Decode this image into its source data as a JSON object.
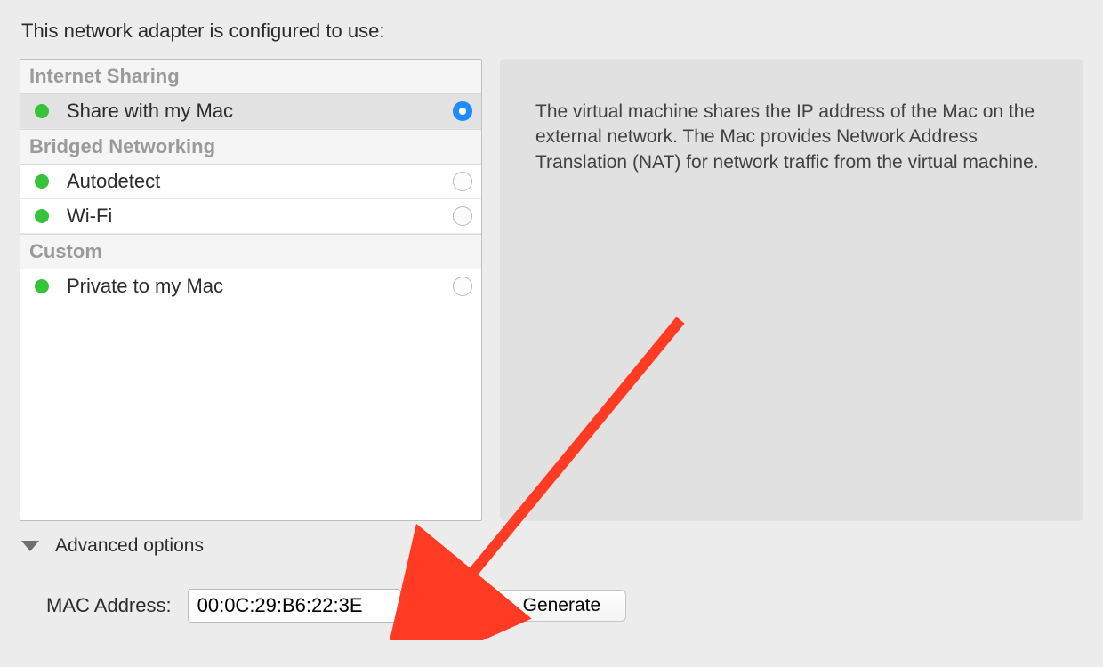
{
  "heading": "This network adapter is configured to use:",
  "groups": [
    {
      "title": "Internet Sharing",
      "items": [
        {
          "label": "Share with my Mac",
          "selected": true
        }
      ]
    },
    {
      "title": "Bridged Networking",
      "items": [
        {
          "label": "Autodetect",
          "selected": false
        },
        {
          "label": "Wi-Fi",
          "selected": false
        }
      ]
    },
    {
      "title": "Custom",
      "items": [
        {
          "label": "Private to my Mac",
          "selected": false
        }
      ]
    }
  ],
  "description": "The virtual machine shares the IP address of the Mac on the external network. The Mac provides Network Address Translation (NAT) for network traffic from the virtual machine.",
  "advanced_label": "Advanced options",
  "mac_label": "MAC Address:",
  "mac_value": "00:0C:29:B6:22:3E",
  "generate_label": "Generate",
  "colors": {
    "status_green": "#35c33a",
    "accent_blue": "#1e8bff",
    "annotation_red": "#ff3b24"
  }
}
